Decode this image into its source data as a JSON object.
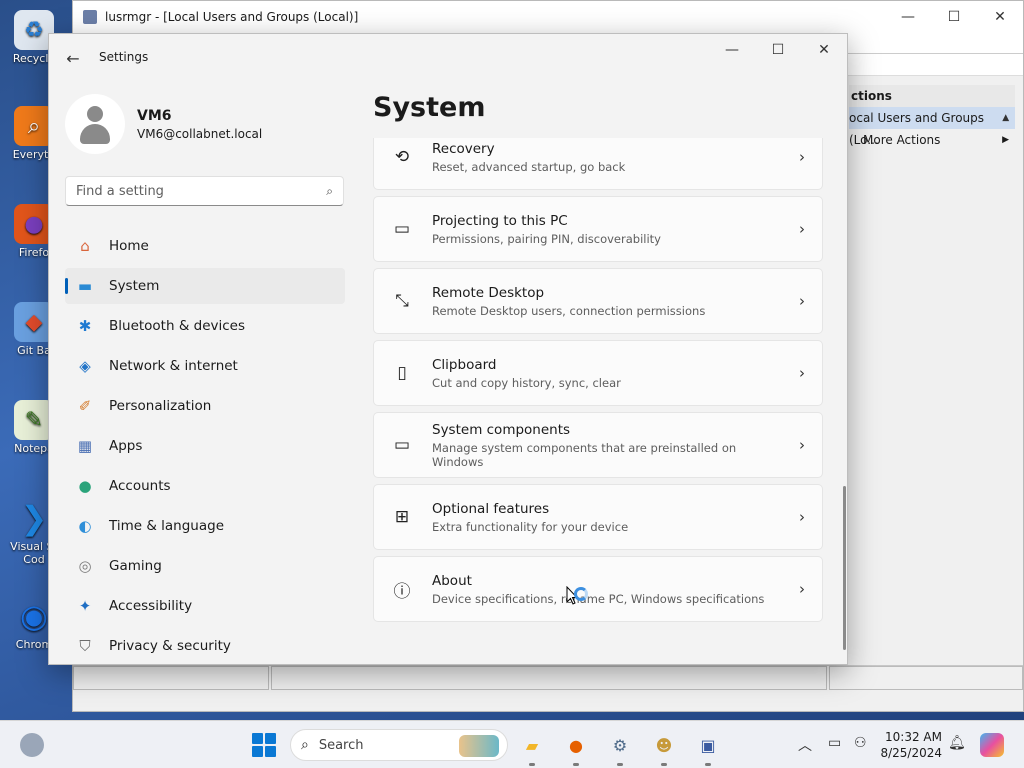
{
  "desktop": {
    "icons": [
      {
        "label": "Recycle",
        "glyph": "♻",
        "color": "#dfe7f0"
      },
      {
        "label": "Everyth",
        "glyph": "⌕",
        "color": "#f07a1a"
      },
      {
        "label": "Firefo",
        "glyph": "●",
        "color": "#e2551b"
      },
      {
        "label": "Git Ba",
        "glyph": "◆",
        "color": "#e24c2c"
      },
      {
        "label": "Notepa",
        "glyph": "✎",
        "color": "#7ab648"
      },
      {
        "label": "Visual St Cod",
        "glyph": "❯",
        "color": "#1e88e5"
      },
      {
        "label": "Chrom",
        "glyph": "◉",
        "color": "#1a73e8"
      }
    ]
  },
  "mmc": {
    "title": "lusrmgr - [Local Users and Groups (Local)]",
    "actions_header": "ctions",
    "actions_selected": "ocal Users and Groups (Lo...",
    "more_actions": "More Actions"
  },
  "settings": {
    "window_title": "Settings",
    "user_name": "VM6",
    "user_email": "VM6@collabnet.local",
    "search_placeholder": "Find a setting",
    "page_title": "System",
    "nav": [
      {
        "label": "Home",
        "icon": "home-icon",
        "glyph": "⌂",
        "color": "#d9653b",
        "active": false
      },
      {
        "label": "System",
        "icon": "system-icon",
        "glyph": "▬",
        "color": "#2a8ad4",
        "active": true
      },
      {
        "label": "Bluetooth & devices",
        "icon": "bluetooth-icon",
        "glyph": "✱",
        "color": "#1f7ad1",
        "active": false
      },
      {
        "label": "Network & internet",
        "icon": "wifi-icon",
        "glyph": "◈",
        "color": "#2173c7",
        "active": false
      },
      {
        "label": "Personalization",
        "icon": "brush-icon",
        "glyph": "✐",
        "color": "#d47a2a",
        "active": false
      },
      {
        "label": "Apps",
        "icon": "apps-icon",
        "glyph": "▦",
        "color": "#4a6fb3",
        "active": false
      },
      {
        "label": "Accounts",
        "icon": "accounts-icon",
        "glyph": "●",
        "color": "#2aa37a",
        "active": false
      },
      {
        "label": "Time & language",
        "icon": "globe-icon",
        "glyph": "◐",
        "color": "#2f8fd8",
        "active": false
      },
      {
        "label": "Gaming",
        "icon": "gamepad-icon",
        "glyph": "◎",
        "color": "#7d7d7d",
        "active": false
      },
      {
        "label": "Accessibility",
        "icon": "accessibility-icon",
        "glyph": "✦",
        "color": "#1f6fc4",
        "active": false
      },
      {
        "label": "Privacy & security",
        "icon": "shield-icon",
        "glyph": "⛉",
        "color": "#6b6b6b",
        "active": false
      }
    ],
    "cards": [
      {
        "title": "Recovery",
        "subtitle": "Reset, advanced startup, go back",
        "icon": "recovery-icon",
        "glyph": "⟲"
      },
      {
        "title": "Projecting to this PC",
        "subtitle": "Permissions, pairing PIN, discoverability",
        "icon": "projector-icon",
        "glyph": "▭"
      },
      {
        "title": "Remote Desktop",
        "subtitle": "Remote Desktop users, connection permissions",
        "icon": "remote-desktop-icon",
        "glyph": "⤡"
      },
      {
        "title": "Clipboard",
        "subtitle": "Cut and copy history, sync, clear",
        "icon": "clipboard-icon",
        "glyph": "▯"
      },
      {
        "title": "System components",
        "subtitle": "Manage system components that are preinstalled on Windows",
        "icon": "components-icon",
        "glyph": "▭"
      },
      {
        "title": "Optional features",
        "subtitle": "Extra functionality for your device",
        "icon": "optional-features-icon",
        "glyph": "⊞"
      },
      {
        "title": "About",
        "subtitle": "Device specifications, rename PC, Windows specifications",
        "icon": "info-icon",
        "glyph": "ⓘ"
      }
    ]
  },
  "taskbar": {
    "search_label": "Search",
    "time": "10:32 AM",
    "date": "8/25/2024",
    "apps": [
      {
        "name": "file-explorer-icon",
        "glyph": "▰",
        "color": "#f2b629"
      },
      {
        "name": "firefox-icon",
        "glyph": "●",
        "color": "#e66000"
      },
      {
        "name": "settings-app-icon",
        "glyph": "⚙",
        "color": "#4f6b8a"
      },
      {
        "name": "users-app-icon",
        "glyph": "☻",
        "color": "#c79a3a"
      },
      {
        "name": "lusrmgr-app-icon",
        "glyph": "▣",
        "color": "#3b5ba0"
      }
    ]
  }
}
